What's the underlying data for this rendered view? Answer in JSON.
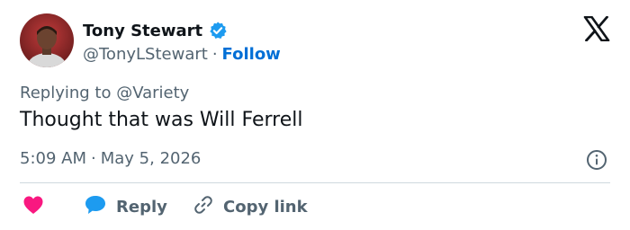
{
  "user": {
    "name": "Tony Stewart",
    "handle": "@TonyLStewart",
    "separator": "·",
    "follow_label": "Follow",
    "avatar_icon": "profile-photo",
    "verified_icon": "verified-badge-icon",
    "verified_color": "#1d9bf0"
  },
  "brand": {
    "logo_icon": "x-logo-icon",
    "logo_color": "#0f1419"
  },
  "tweet": {
    "replying_to": "Replying to @Variety",
    "text": "Thought that was Will Ferrell",
    "time": "5:09 AM",
    "separator": "·",
    "date": "May 5, 2026",
    "info_icon": "info-icon"
  },
  "actions": {
    "like_icon": "heart-icon",
    "like_color": "#f91880",
    "reply_label": "Reply",
    "reply_icon": "speech-bubble-icon",
    "reply_color": "#1d9bf0",
    "copy_label": "Copy link",
    "copy_icon": "link-icon"
  },
  "colors": {
    "text": "#0f1419",
    "secondary": "#536471",
    "link": "#006fd6",
    "divider": "#cfd9de"
  }
}
